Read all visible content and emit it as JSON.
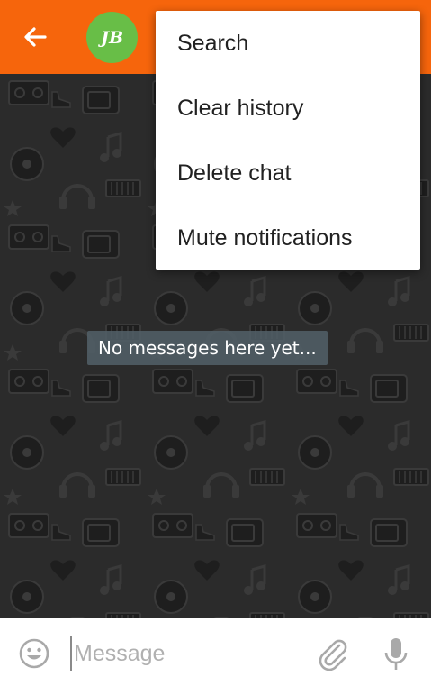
{
  "header": {
    "back_icon": "arrow-back-icon",
    "avatar_initials": "JB",
    "background_color": "#f6650c",
    "avatar_color": "#68be47"
  },
  "overflow_menu": {
    "items": [
      {
        "label": "Search"
      },
      {
        "label": "Clear history"
      },
      {
        "label": "Delete chat"
      },
      {
        "label": "Mute notifications"
      }
    ]
  },
  "chat": {
    "empty_text": "No messages here yet...",
    "wallpaper": "doodle-pattern",
    "wallpaper_color": "#2b2b2b"
  },
  "composer": {
    "placeholder": "Message",
    "value": "",
    "emoji_icon": "smiley-icon",
    "attach_icon": "paperclip-icon",
    "mic_icon": "microphone-icon"
  }
}
